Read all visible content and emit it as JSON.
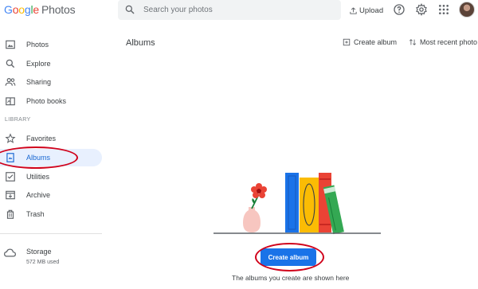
{
  "header": {
    "logo": {
      "letters": [
        "G",
        "o",
        "o",
        "g",
        "l",
        "e"
      ],
      "product": "Photos"
    },
    "search_placeholder": "Search your photos",
    "upload_label": "Upload"
  },
  "sidebar": {
    "items": [
      {
        "label": "Photos",
        "icon": "image-icon"
      },
      {
        "label": "Explore",
        "icon": "search-icon"
      },
      {
        "label": "Sharing",
        "icon": "people-icon"
      },
      {
        "label": "Photo books",
        "icon": "book-icon"
      }
    ],
    "library_heading": "LIBRARY",
    "library_items": [
      {
        "label": "Favorites",
        "icon": "star-icon"
      },
      {
        "label": "Albums",
        "icon": "album-icon",
        "active": true
      },
      {
        "label": "Utilities",
        "icon": "checklist-icon"
      },
      {
        "label": "Archive",
        "icon": "archive-icon"
      },
      {
        "label": "Trash",
        "icon": "trash-icon"
      }
    ],
    "storage": {
      "label": "Storage",
      "used": "572 MB used"
    }
  },
  "main": {
    "title": "Albums",
    "create_album_label": "Create album",
    "sort_label": "Most recent photo",
    "empty_button": "Create album",
    "empty_text": "The albums you create are shown here"
  },
  "colors": {
    "accent": "#1a73e8",
    "active_bg": "#e8f0fe",
    "annotation": "#d0021b"
  }
}
